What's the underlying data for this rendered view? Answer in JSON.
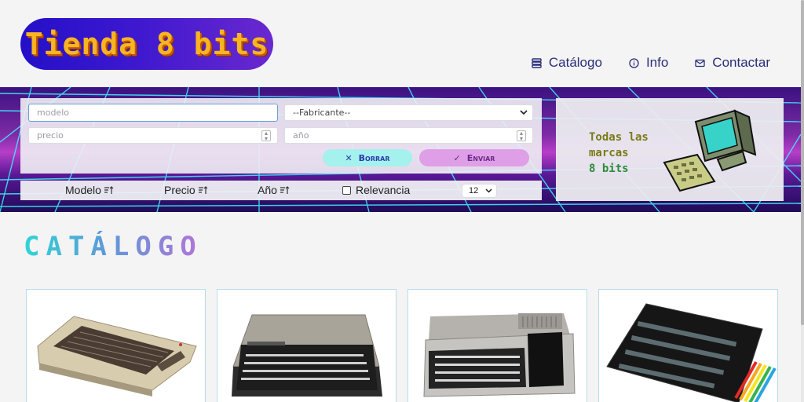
{
  "header": {
    "logo_text": "Tienda 8 bits",
    "nav": [
      {
        "label": "Catálogo",
        "icon": "stack-icon"
      },
      {
        "label": "Info",
        "icon": "info-icon"
      },
      {
        "label": "Contactar",
        "icon": "envelope-icon"
      }
    ]
  },
  "search": {
    "model_placeholder": "modelo",
    "maker_selected": "--Fabricante--",
    "price_placeholder": "precio",
    "year_placeholder": "año",
    "clear_label": "Borrar",
    "send_label": "Enviar"
  },
  "sort": {
    "model_label": "Modelo",
    "price_label": "Precio",
    "year_label": "Año",
    "relevance_label": "Relevancia",
    "relevance_checked": false,
    "per_page": "12"
  },
  "promo": {
    "line1": "Todas las",
    "line2": "marcas",
    "line3": "8 bits"
  },
  "catalog": {
    "title": "CATÁLOGO",
    "products": [
      {
        "image": "beige-home-computer"
      },
      {
        "image": "black-home-computer"
      },
      {
        "image": "silver-black-home-computer"
      },
      {
        "image": "black-rubber-key-computer"
      }
    ]
  },
  "colors": {
    "accent_navy": "#2a2d78",
    "logo_yellow": "#f7b521",
    "clear_button": "#a4f1ee",
    "send_button": "#de9fe6"
  }
}
